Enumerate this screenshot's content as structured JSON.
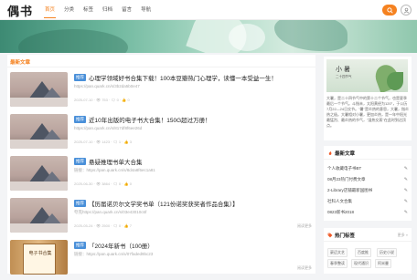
{
  "header": {
    "logo": "偶书",
    "nav": [
      "首页",
      "分类",
      "标签",
      "归档",
      "留言",
      "导航"
    ],
    "active_nav": "首页"
  },
  "main": {
    "section_title": "最新文章",
    "posts": [
      {
        "tag": "推荐",
        "title": "心理学领域好书合集下载！100本豆瓣热门心理学，读懂一本受益一生！",
        "link": "https://pan.quark.cn/s/3b2da5b0e47",
        "meta": "2025-07-10 · 👁 753 · 🗨 0 · 👍 0",
        "more": ""
      },
      {
        "tag": "推荐",
        "title": "近10年出版的电子书大合集！150G超过万册！",
        "link": "https://pan.quark.cn/s/817df8f6ee26d",
        "meta": "2025-07-10 · 👁 1423 · 🗨 1 · 👍 3",
        "more": ""
      },
      {
        "tag": "推荐",
        "title": "悬疑推理书单大合集",
        "link": "链接：https://pan.quark.cn/s/8d4a8f6ec1a81",
        "meta": "2025-06-30 · 👁 3864 · 🗨 0 · 👍 0",
        "more": ""
      },
      {
        "tag": "推荐",
        "title": "【历届诺贝尔文学奖书单（121份诺奖获奖者作品合集）】",
        "link": "夸克https://pan.quark.cn/s/03e43010c6f",
        "meta": "2025-05-24 · 👁 2500 · 🗨 0 · 👍 7",
        "more": "阅读更多"
      },
      {
        "tag": "推荐",
        "title": "「2024年新书（100册）",
        "link": "链接：https://pan.quark.cn/s/07faded9bc23",
        "meta": "",
        "more": "阅读更多"
      }
    ],
    "book_cover_text": "电子书合集"
  },
  "sidebar": {
    "promo_title": "小暑",
    "promo_sub": "二十四节气",
    "promo_text": "大暑，是二十四节气中的第十二个节气，也是夏季最后一个节气。斗指未，太阳黄经为120°，于公历7月22—24日交节。\"暑\"是炎热的意思，大暑，指炎热之极。大暑相对小暑，更加炎热，是一年中阳光最猛烈、最炎热的节气，\"湿热交蒸\"在此时到达顶点。",
    "recent_title": "最新文章",
    "recent": [
      "个人收藏电子书BT",
      "08月23热门付费文章",
      "2-Library店铺最新国图书",
      "社科人文合集",
      "0823新书2018"
    ],
    "tags_title": "热门标签",
    "tags_more": "更多 »",
    "tags": [
      "豪迈文艺",
      "百度推",
      "历史小说",
      "春季整读",
      "现代通识",
      "阿米曼"
    ]
  }
}
